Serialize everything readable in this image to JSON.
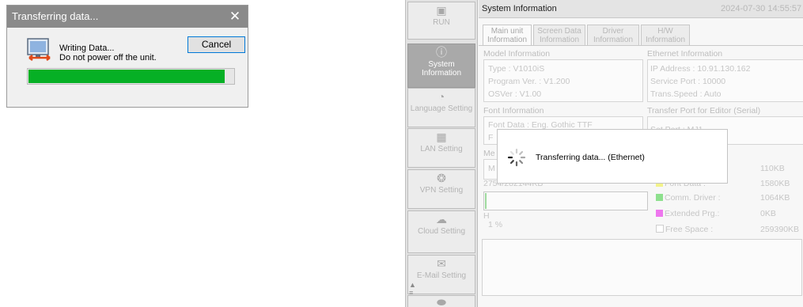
{
  "dialog": {
    "title": "Transferring data...",
    "close": "✕",
    "message_line1": "Writing Data...",
    "message_line2": "Do not power off the unit.",
    "cancel_label": "Cancel",
    "progress": 0.95,
    "progress_color": "#06b025"
  },
  "hmi": {
    "sidebar": [
      {
        "icon": "▣",
        "label": "RUN"
      },
      {
        "icon": "ⓘ",
        "label": "System Information"
      },
      {
        "icon": "◔",
        "label": "Language Setting"
      },
      {
        "icon": "▦",
        "label": "LAN Setting"
      },
      {
        "icon": "❂",
        "label": "VPN Setting"
      },
      {
        "icon": "☁",
        "label": "Cloud Setting"
      },
      {
        "icon": "✉",
        "label": "E-Mail Setting"
      }
    ],
    "header": {
      "title": "System Information",
      "datetime": "2024-07-30  14:55:57"
    },
    "tabs": [
      {
        "line1": "Main unit",
        "line2": "Information"
      },
      {
        "line1": "Screen Data",
        "line2": "Information"
      },
      {
        "line1": "Driver",
        "line2": "Information"
      },
      {
        "line1": "H/W",
        "line2": "Information"
      }
    ],
    "model": {
      "heading": "Model Information",
      "type": "Type          :  V1010iS",
      "program": "Program Ver. :  V1.200",
      "os": "OSVer         :  V1.00"
    },
    "ethernet": {
      "heading": "Ethernet Information",
      "ip": "IP Address   :  10.91.130.162",
      "port": "Service Port  :  10000",
      "speed": "Trans.Speed  :  Auto"
    },
    "font": {
      "heading": "Font Information",
      "data": "Font Data  :  Eng. Gothic TTF",
      "partial": "F"
    },
    "serial": {
      "heading": "Transfer Port for Editor (Serial)",
      "port": "Set Port  :  MJ1"
    },
    "memory": {
      "heading_partial": "Me",
      "row_partial": "M",
      "usage": "2754/282144KB",
      "h_partial": "H",
      "percent": "1 %",
      "usage_fraction": 0.01
    },
    "legend": [
      {
        "label": "",
        "value": "110KB",
        "color": ""
      },
      {
        "label": "Font Data   :",
        "value": "1580KB",
        "color": "#f2f28a"
      },
      {
        "label": "Comm. Driver :",
        "value": "1064KB",
        "color": "#8ee08e"
      },
      {
        "label": "Extended Prg.:",
        "value": "0KB",
        "color": "#ee77ee"
      },
      {
        "label": "Free Space   :",
        "value": "259390KB",
        "color": "#ffffff"
      }
    ],
    "modal": {
      "text": "Transferring data... (Ethernet)"
    }
  }
}
